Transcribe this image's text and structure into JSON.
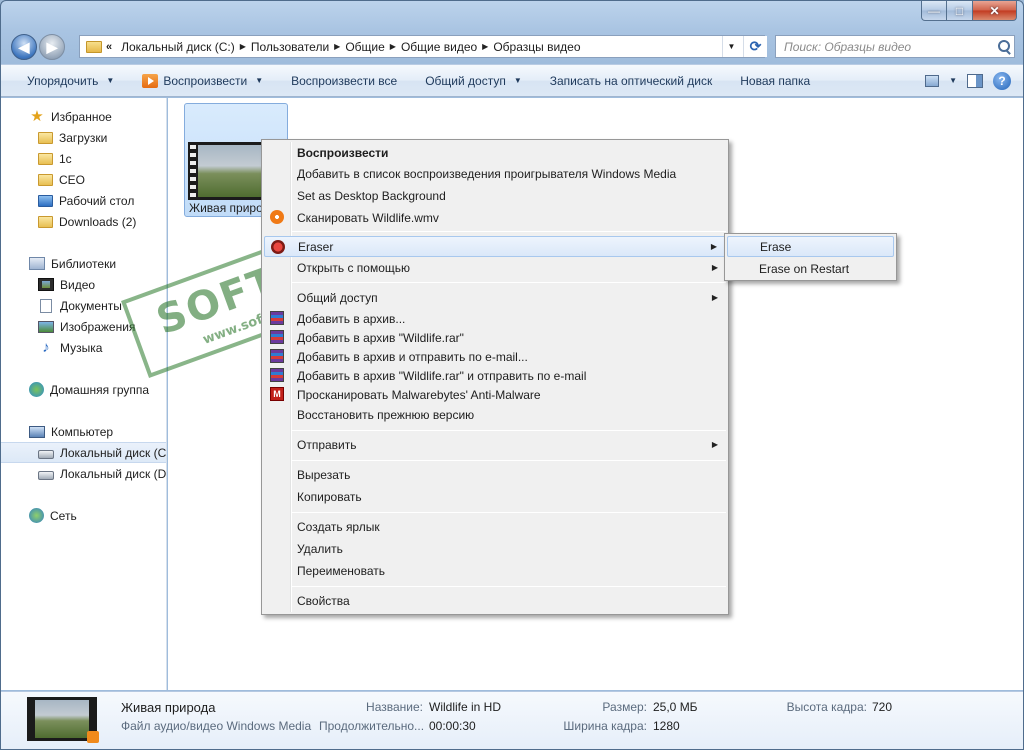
{
  "address": {
    "overflow": "«",
    "crumbs": [
      "Локальный диск (C:)",
      "Пользователи",
      "Общие",
      "Общие видео",
      "Образцы видео"
    ]
  },
  "search": {
    "placeholder": "Поиск: Образцы видео"
  },
  "toolbar": {
    "organize": "Упорядочить",
    "play": "Воспроизвести",
    "play_all": "Воспроизвести все",
    "share": "Общий доступ",
    "burn": "Записать на оптический диск",
    "new_folder": "Новая папка"
  },
  "sidebar": {
    "favorites": "Избранное",
    "downloads": "Загрузки",
    "item_1c": "1с",
    "ceo": "CEO",
    "desktop": "Рабочий стол",
    "downloads_en": "Downloads (2)",
    "libraries": "Библиотеки",
    "video": "Видео",
    "documents": "Документы",
    "images": "Изображения",
    "music": "Музыка",
    "homegroup": "Домашняя группа",
    "computer": "Компьютер",
    "disk_c": "Локальный диск (C",
    "disk_d": "Локальный диск (D",
    "network": "Сеть"
  },
  "file": {
    "name": "Живая природа"
  },
  "context_menu": {
    "play": "Воспроизвести",
    "add_playlist": "Добавить в список воспроизведения проигрывателя Windows Media",
    "set_bg": "Set as Desktop Background",
    "scan": "Сканировать Wildlife.wmv",
    "eraser": "Eraser",
    "open_with": "Открыть с помощью",
    "share": "Общий доступ",
    "add_archive": "Добавить в архив...",
    "add_rar": "Добавить в архив \"Wildlife.rar\"",
    "add_email": "Добавить в архив и отправить по e-mail...",
    "add_rar_email": "Добавить в архив \"Wildlife.rar\" и отправить по e-mail",
    "malwarebytes": "Просканировать Malwarebytes' Anti-Malware",
    "restore": "Восстановить прежнюю версию",
    "send_to": "Отправить",
    "cut": "Вырезать",
    "copy": "Копировать",
    "shortcut": "Создать ярлык",
    "delete": "Удалить",
    "rename": "Переименовать",
    "properties": "Свойства"
  },
  "submenu": {
    "erase": "Erase",
    "erase_restart": "Erase on Restart"
  },
  "watermark": {
    "brand": "SOFTPORTAL",
    "url": "www.softportal.com",
    "tm": "™"
  },
  "details": {
    "name": "Живая природа",
    "type": "Файл аудио/видео Windows Media",
    "title_label": "Название:",
    "title_value": "Wildlife in HD",
    "duration_label": "Продолжительно...",
    "duration_value": "00:00:30",
    "size_label": "Размер:",
    "size_value": "25,0 МБ",
    "width_label": "Ширина кадра:",
    "width_value": "1280",
    "height_label": "Высота кадра:",
    "height_value": "720"
  }
}
